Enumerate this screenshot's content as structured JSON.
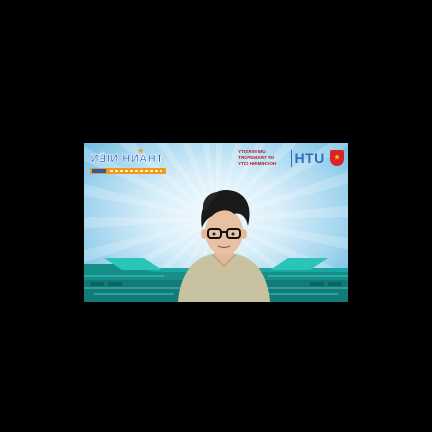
{
  "screen": {
    "background": "#000000",
    "video_tile": {
      "participant": "video-participant",
      "banner_left": {
        "headline": "THANH NIÊN",
        "mirrored": true,
        "accent_color": "#f29a17",
        "brand_color": "#1d5fb5"
      },
      "banner_right": {
        "mark": "UTH",
        "institution_lines": [
          "UNIVERSITY",
          "OF TRANSPORT",
          "HOCHIMINH CITY"
        ],
        "mirrored": true,
        "badge_icon": "youth-union-badge-icon"
      },
      "colors": {
        "sky": "#9fd3ee",
        "floor": "#1aa7a0",
        "shirt": "#c9c2a0",
        "hair": "#1a1a1a"
      }
    }
  }
}
